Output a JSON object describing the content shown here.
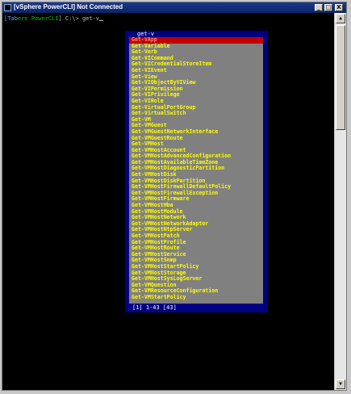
{
  "window": {
    "title": "[vSphere PowerCLI] Not Connected",
    "buttons": {
      "minimize": "_",
      "maximize": "□",
      "close": "X"
    }
  },
  "console": {
    "prompt_tab": "[Tab",
    "prompt_rest": "ere PowerCLI",
    "prompt_tail": "] C:\\> get-v",
    "prompt_green": "l"
  },
  "popup": {
    "header": "get-v",
    "items": [
      "Get-VApp",
      "Get-Variable",
      "Get-Verb",
      "Get-VICommand",
      "Get-VICredentialStoreItem",
      "Get-VIEvent",
      "Get-View",
      "Get-VIObjectByVIView",
      "Get-VIPermission",
      "Get-VIPrivilege",
      "Get-VIRole",
      "Get-VirtualPortGroup",
      "Get-VirtualSwitch",
      "Get-VM",
      "Get-VMGuest",
      "Get-VMGuestNetworkInterface",
      "Get-VMGuestRoute",
      "Get-VMHost",
      "Get-VMHostAccount",
      "Get-VMHostAdvancedConfiguration",
      "Get-VMHostAvailableTimeZone",
      "Get-VMHostDiagnosticPartition",
      "Get-VMHostDisk",
      "Get-VMHostDiskPartition",
      "Get-VMHostFirewallDefaultPolicy",
      "Get-VMHostFirewallException",
      "Get-VMHostFirmware",
      "Get-VMHostHba",
      "Get-VMHostModule",
      "Get-VMHostNetwork",
      "Get-VMHostNetworkAdapter",
      "Get-VMHostNtpServer",
      "Get-VMHostPatch",
      "Get-VMHostProfile",
      "Get-VMHostRoute",
      "Get-VMHostService",
      "Get-VMHostSnmp",
      "Get-VMHostStartPolicy",
      "Get-VMHostStorage",
      "Get-VMHostSysLogServer",
      "Get-VMQuestion",
      "Get-VMResourceConfiguration",
      "Get-VMStartPolicy"
    ],
    "selected_index": 0,
    "footer": "[1] 1-43 [43]"
  },
  "colors": {
    "console_bg": "#000000",
    "popup_bg": "#000080",
    "list_bg": "#808080",
    "item_text": "#ffff00",
    "selected_bg": "#c00000"
  }
}
